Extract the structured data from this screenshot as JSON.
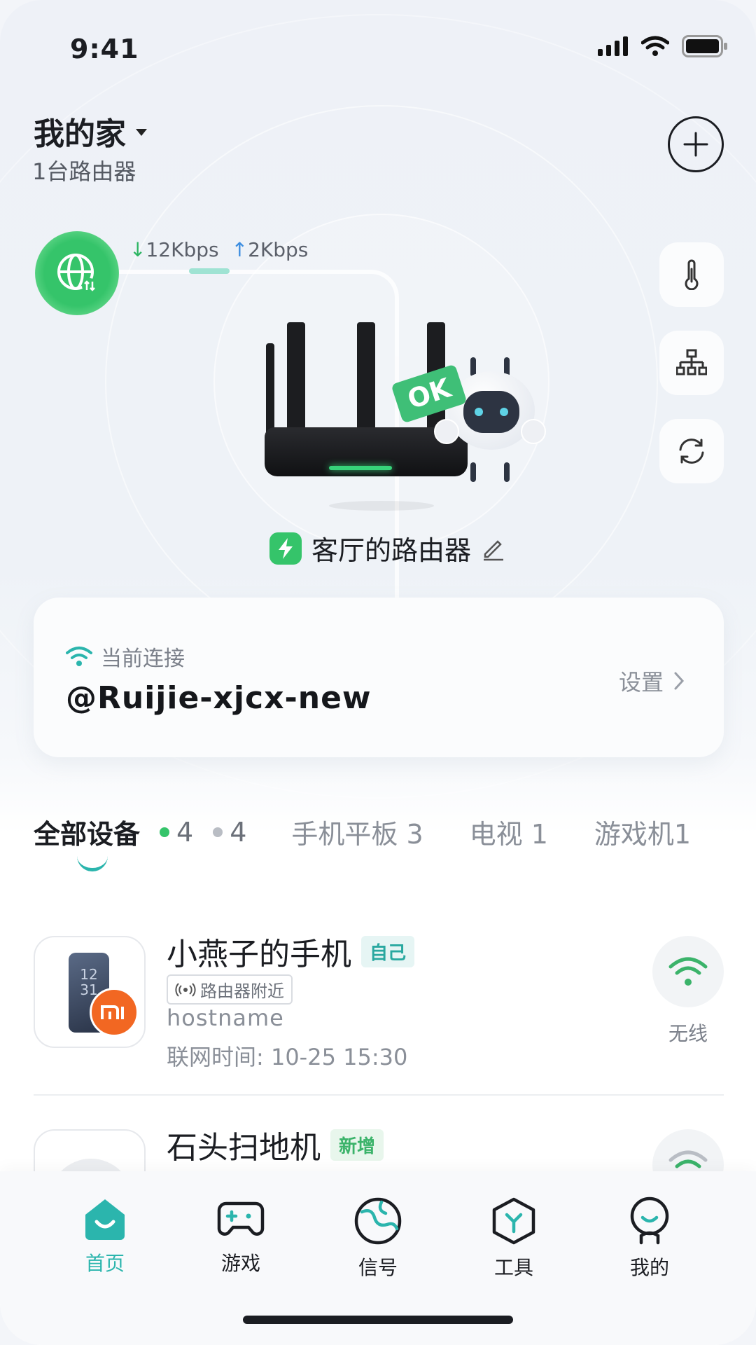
{
  "status_bar": {
    "time": "9:41"
  },
  "header": {
    "home_name": "我的家",
    "router_count": "1台路由器"
  },
  "network": {
    "download": "12Kbps",
    "upload": "2Kbps"
  },
  "router": {
    "status_tag": "OK",
    "name": "客厅的路由器"
  },
  "connection": {
    "label": "当前连接",
    "ssid": "@Ruijie-xjcx-new",
    "settings_label": "设置"
  },
  "tabs": {
    "all": "全部设备",
    "online_count": "4",
    "offline_count": "4",
    "items": [
      "手机平板 3",
      "电视 1",
      "游戏机1"
    ]
  },
  "devices": [
    {
      "name": "小燕子的手机",
      "tag": "自己",
      "location": "路由器附近",
      "hostname": "hostname",
      "online_time": "联网时间: 10-25 15:30",
      "connection_type": "无线",
      "thumb_time": "12\n31",
      "brand_badge": "mi"
    },
    {
      "name": "石头扫地机",
      "tag": "新增"
    }
  ],
  "nav": {
    "items": [
      {
        "label": "首页",
        "icon": "home-icon",
        "active": true
      },
      {
        "label": "游戏",
        "icon": "gamepad-icon"
      },
      {
        "label": "信号",
        "icon": "globe-icon"
      },
      {
        "label": "工具",
        "icon": "toolbox-icon"
      },
      {
        "label": "我的",
        "icon": "profile-icon"
      }
    ]
  },
  "colors": {
    "accent": "#2bb5ad",
    "online": "#35c46a",
    "wifi_green": "#3bb36a"
  }
}
